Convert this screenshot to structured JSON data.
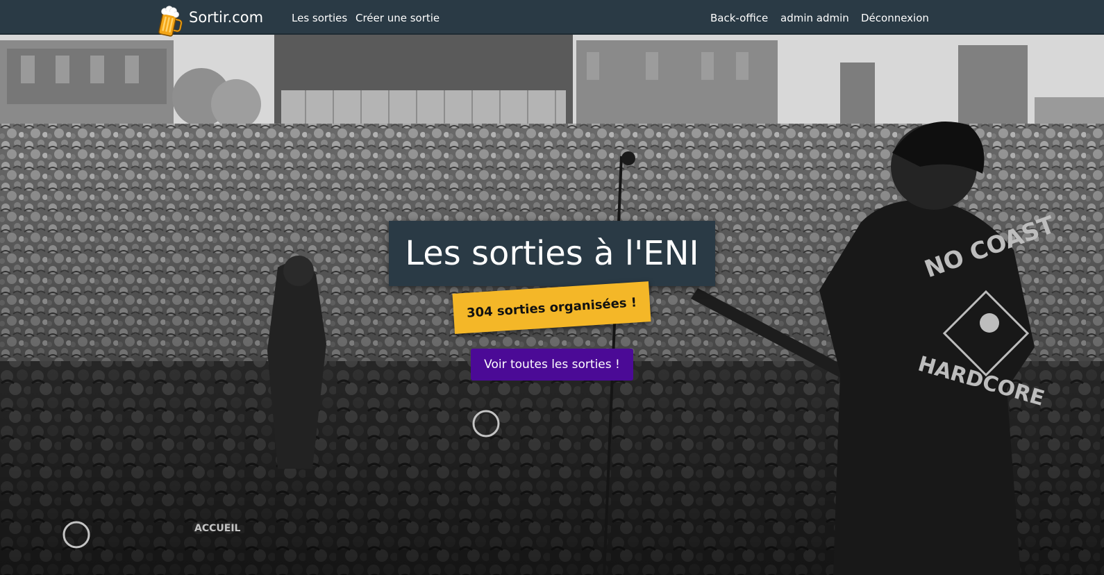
{
  "navbar": {
    "brand": "Sortir.com",
    "links": [
      "Les sorties",
      "Créer une sortie"
    ],
    "right_links": [
      "Back-office",
      "admin admin",
      "Déconnexion"
    ]
  },
  "hero": {
    "title": "Les sorties à l'ENI",
    "badge": "304 sorties organisées !",
    "cta": "Voir toutes les sorties !",
    "shirt_text_1": "NO COAST",
    "shirt_text_2": "HARDCORE",
    "shirt_text_3": "ACCUEIL"
  },
  "colors": {
    "navbar": "#2a3a45",
    "badge": "#f4b728",
    "cta": "#4b0a96"
  },
  "icons": {
    "brand_logo": "beer-mug-icon"
  }
}
